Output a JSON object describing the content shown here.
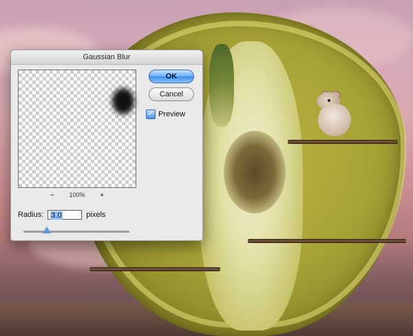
{
  "dialog": {
    "title": "Gaussian Blur",
    "ok_label": "OK",
    "cancel_label": "Cancel",
    "preview_label": "Preview",
    "preview_checked": true,
    "zoom": {
      "minus": "−",
      "value": "100%",
      "plus": "+"
    },
    "radius": {
      "label": "Radius:",
      "value": "3.0",
      "unit": "pixels"
    },
    "slider_level_fraction": 0.22
  }
}
